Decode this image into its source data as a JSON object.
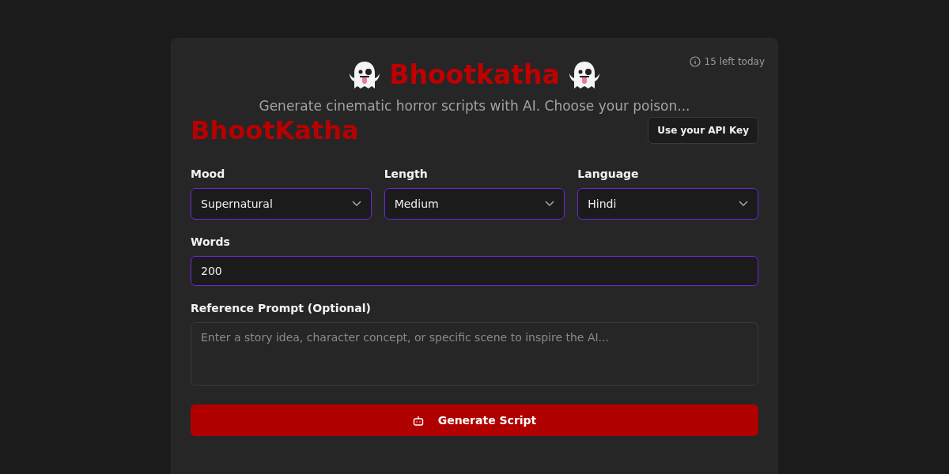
{
  "quota": "15 left today",
  "header": {
    "title": "Bhootkatha",
    "subtitle": "Generate cinematic horror scripts with AI. Choose your poison..."
  },
  "brand": "BhootKatha",
  "api_button": "Use your API Key",
  "selects": [
    {
      "label": "Mood",
      "value": "Supernatural"
    },
    {
      "label": "Length",
      "value": "Medium"
    },
    {
      "label": "Language",
      "value": "Hindi"
    }
  ],
  "words": {
    "label": "Words",
    "value": "200"
  },
  "prompt": {
    "label": "Reference Prompt (Optional)",
    "placeholder": "Enter a story idea, character concept, or specific scene to inspire the AI..."
  },
  "generate_button": "Generate Script"
}
